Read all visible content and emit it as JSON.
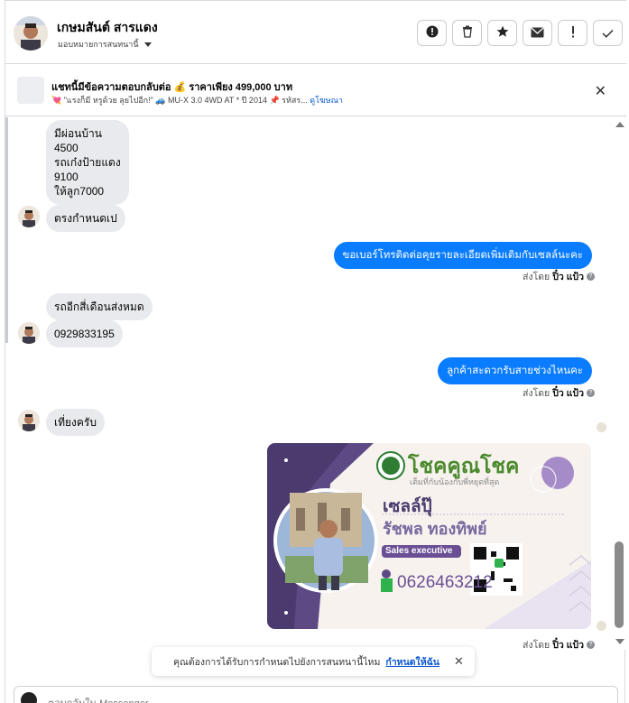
{
  "header": {
    "contact_name": "เกษมสันต์ สารแดง",
    "assign_label": "มอบหมายการสนทนานี้",
    "actions": [
      {
        "name": "report-button",
        "glyph": "!"
      },
      {
        "name": "delete-button",
        "glyph": "🗑"
      },
      {
        "name": "star-button",
        "glyph": "★"
      },
      {
        "name": "mail-button",
        "glyph": "✉"
      },
      {
        "name": "mark-spam-button",
        "glyph": "!"
      },
      {
        "name": "mark-done-button",
        "glyph": "✓"
      }
    ]
  },
  "listing": {
    "title": "แชทนี้มีข้อความตอบกลับต่อ 💰 ราคาเพียง 499,000 บาท",
    "subtitle": "💘 \"แรงก็มี หรูด้วย ลุยไปอีก!\" 🚙 MU-X 3.0 4WD AT * ปี 2014 📌 รหัสร...",
    "link_label": "ดูโฆษณา"
  },
  "messages": {
    "incoming_1": "มีผ่อนบ้าน\n4500\nรถเก๋งป้ายแดง\n9100\nให้ลูก7000",
    "incoming_2": "ตรงกำหนดเป",
    "outgoing_1": "ขอเบอร์โทรติดต่อคุยรายละเอียดเพิ่มเติมกับเซลล์นะคะ",
    "incoming_3": "รถอีกสี่เดือนส่งหมด",
    "incoming_4": "0929833195",
    "outgoing_2": "ลูกค้าสะดวกรับสายช่วงไหนคะ",
    "incoming_5": "เที่ยงครับ"
  },
  "sent_by": {
    "prefix": "ส่งโดย",
    "name": "ปิ๋ว แป้ว"
  },
  "card": {
    "brand": "โชคคูณโชค",
    "tagline": "เต็มที่กับน้องกับพี่หยุดที่สุด",
    "nick": "เซลล์ปุ๊",
    "name": "รัชพล ทองทิพย์",
    "role": "Sales executive",
    "phone": "0626463212"
  },
  "toast": {
    "text": "คุณต้องการได้รับการกำหนดไปยังการสนทนานี้ไหม",
    "link": "กำหนดให้ฉัน"
  },
  "composer": {
    "placeholder": "ตอบกลับใน Messenger"
  },
  "colors": {
    "accent": "#0a7cff",
    "incoming_bubble": "#e9eaed",
    "card_purple": "#6a4f95"
  }
}
